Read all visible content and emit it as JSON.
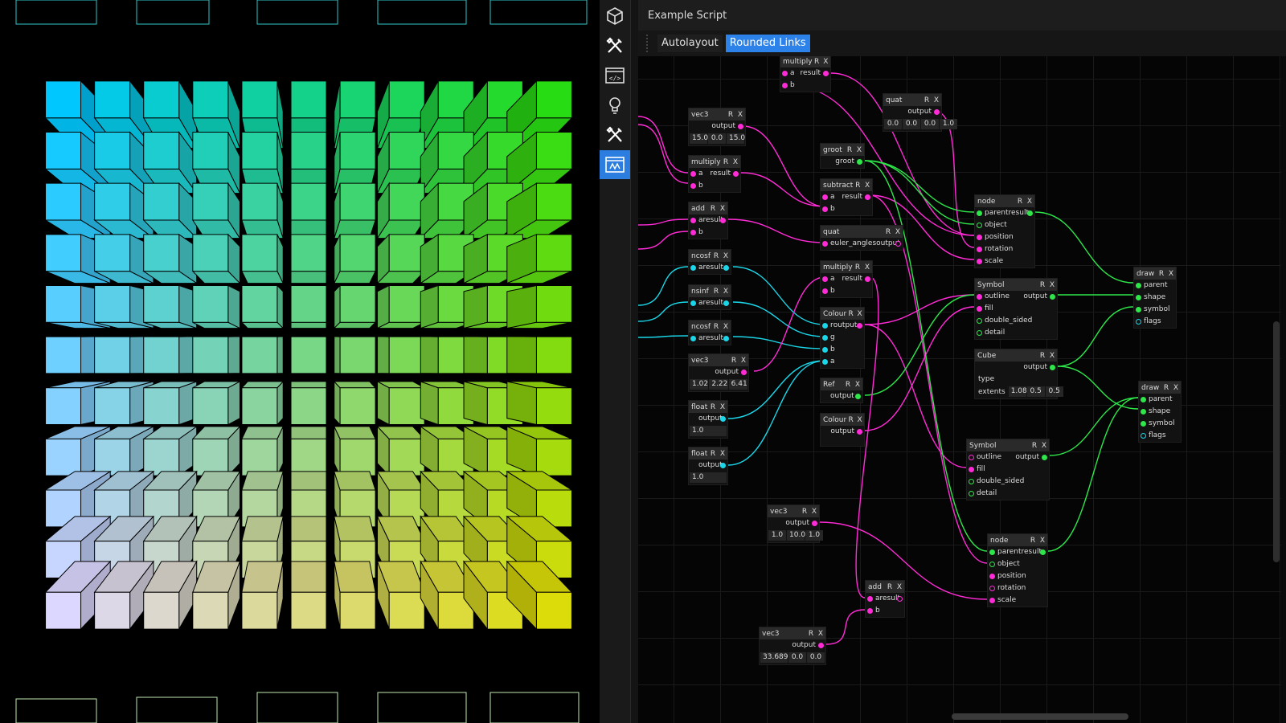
{
  "toolbar": {
    "items": [
      {
        "icon": "cube-icon"
      },
      {
        "icon": "tools-icon"
      },
      {
        "icon": "code-icon"
      },
      {
        "icon": "bulb-icon"
      },
      {
        "icon": "tools-icon"
      },
      {
        "icon": "script-editor-icon",
        "active": true
      }
    ]
  },
  "editor": {
    "title": "Example Script",
    "buttons": {
      "autolayout": "Autolayout",
      "rounded_links": "Rounded Links"
    },
    "accent": "#2d82ea"
  },
  "link_colors": {
    "magenta": "#ff2bd6",
    "cyan": "#1ad6e8",
    "green": "#2ee64a"
  },
  "nodes": {
    "multiply_top": {
      "title": "multiply",
      "r": "R",
      "x": "X",
      "a": "a",
      "b": "b",
      "result": "result"
    },
    "quat_top": {
      "title": "quat",
      "r": "R",
      "x": "X",
      "output": "output",
      "vals": [
        "0.0",
        "0.0",
        "0.0",
        "1.0"
      ]
    },
    "vec3_a": {
      "title": "vec3",
      "r": "R",
      "x": "X",
      "output": "output",
      "vals": [
        "15.0",
        "0.0",
        "15.0"
      ]
    },
    "multiply_b": {
      "title": "multiply",
      "r": "R",
      "x": "X",
      "a": "a",
      "b": "b",
      "result": "result"
    },
    "groot": {
      "title": "groot",
      "r": "R",
      "x": "X",
      "out": "groot"
    },
    "subtract": {
      "title": "subtract",
      "r": "R",
      "x": "X",
      "a": "a",
      "b": "b",
      "result": "result"
    },
    "add_a": {
      "title": "add",
      "r": "R",
      "x": "X",
      "a": "a",
      "b": "b",
      "result": "result"
    },
    "quat_euler": {
      "title": "quat",
      "r": "R",
      "x": "X",
      "in": "euler_angles",
      "output": "output"
    },
    "node_a": {
      "title": "node",
      "r": "R",
      "x": "X",
      "parent": "parent",
      "result": "result",
      "object": "object",
      "position": "position",
      "rotation": "rotation",
      "scale": "scale"
    },
    "ncosf_a": {
      "title": "ncosf",
      "r": "R",
      "x": "X",
      "a": "a",
      "result": "result"
    },
    "multiply_c": {
      "title": "multiply",
      "r": "R",
      "x": "X",
      "a": "a",
      "b": "b",
      "result": "result"
    },
    "draw_a": {
      "title": "draw",
      "r": "R",
      "x": "X",
      "parent": "parent",
      "shape": "shape",
      "symbol": "symbol",
      "flags": "flags"
    },
    "nsinf": {
      "title": "nsinf",
      "r": "R",
      "x": "X",
      "a": "a",
      "result": "result"
    },
    "symbol_a": {
      "title": "Symbol",
      "r": "R",
      "x": "X",
      "outline": "outline",
      "output": "output",
      "fill": "fill",
      "double_sided": "double_sided",
      "detail": "detail"
    },
    "colour_a": {
      "title": "Colour",
      "r": "R",
      "x": "X",
      "rr": "r",
      "output": "output",
      "g": "g",
      "b": "b",
      "a": "a"
    },
    "ncosf_b": {
      "title": "ncosf",
      "r": "R",
      "x": "X",
      "a": "a",
      "result": "result"
    },
    "cube": {
      "title": "Cube",
      "r": "R",
      "x": "X",
      "output": "output",
      "type": "type",
      "extents": "extents",
      "vals": [
        "1.08",
        "0.5",
        "0.5"
      ]
    },
    "vec3_b": {
      "title": "vec3",
      "r": "R",
      "x": "X",
      "output": "output",
      "vals": [
        "1.02",
        "2.22",
        "6.41"
      ]
    },
    "ref": {
      "title": "Ref",
      "r": "R",
      "x": "X",
      "output": "output"
    },
    "draw_b": {
      "title": "draw",
      "r": "R",
      "x": "X",
      "parent": "parent",
      "shape": "shape",
      "symbol": "symbol",
      "flags": "flags"
    },
    "float_a": {
      "title": "float",
      "r": "R",
      "x": "X",
      "output": "output",
      "vals": [
        "1.0"
      ]
    },
    "colour_b": {
      "title": "Colour",
      "r": "R",
      "x": "X",
      "output": "output"
    },
    "symbol_b": {
      "title": "Symbol",
      "r": "R",
      "x": "X",
      "outline": "outline",
      "output": "output",
      "fill": "fill",
      "double_sided": "double_sided",
      "detail": "detail"
    },
    "float_b": {
      "title": "float",
      "r": "R",
      "x": "X",
      "output": "output",
      "vals": [
        "1.0"
      ]
    },
    "vec3_c": {
      "title": "vec3",
      "r": "R",
      "x": "X",
      "output": "output",
      "vals": [
        "1.0",
        "10.0",
        "1.0"
      ]
    },
    "node_b": {
      "title": "node",
      "r": "R",
      "x": "X",
      "parent": "parent",
      "result": "result",
      "object": "object",
      "position": "position",
      "rotation": "rotation",
      "scale": "scale"
    },
    "add_b": {
      "title": "add",
      "r": "R",
      "x": "X",
      "a": "a",
      "b": "b",
      "result": "result"
    },
    "vec3_d": {
      "title": "vec3",
      "r": "R",
      "x": "X",
      "output": "output",
      "vals": [
        "33.689",
        "0.0",
        "0.0"
      ]
    }
  }
}
